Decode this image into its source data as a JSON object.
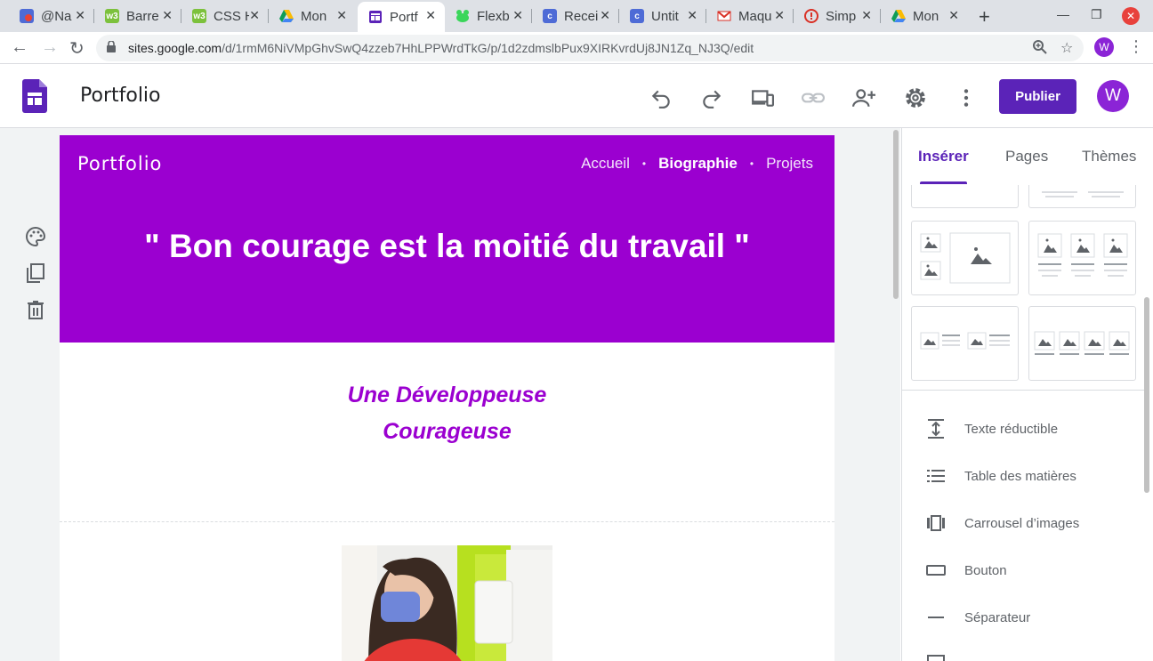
{
  "browser": {
    "tabs": [
      {
        "title": "@Na",
        "fav_color": "#4e6bd6",
        "fav_char": ""
      },
      {
        "title": "Barre",
        "fav_color": "#7cc13c",
        "fav_char": "w3"
      },
      {
        "title": "CSS H",
        "fav_color": "#7cc13c",
        "fav_char": "w3"
      },
      {
        "title": "Mon",
        "fav_color": "#fbbc04",
        "fav_char": ""
      },
      {
        "title": "Portf",
        "fav_color": "#5b23b8",
        "fav_char": ""
      },
      {
        "title": "Flexb",
        "fav_color": "#3ad65a",
        "fav_char": ""
      },
      {
        "title": "Recei",
        "fav_color": "#4e6bd6",
        "fav_char": "c"
      },
      {
        "title": "Untit",
        "fav_color": "#4e6bd6",
        "fav_char": "c"
      },
      {
        "title": "Maqu",
        "fav_color": "#ffffff",
        "fav_char": "M"
      },
      {
        "title": "Simp",
        "fav_color": "#d93025",
        "fav_char": "!"
      },
      {
        "title": "Mon",
        "fav_color": "#fbbc04",
        "fav_char": ""
      }
    ],
    "active_tab": 4,
    "url_host": "sites.google.com",
    "url_path": "/d/1rmM6NiVMpGhvSwQ4zzeb7HhLPPWrdTkG/p/1d2zdmslbPux9XIRKvrdUj8JN1Zq_NJ3Q/edit",
    "profile_initial": "W"
  },
  "app": {
    "title": "Portfolio",
    "publish_label": "Publier",
    "avatar_initial": "W",
    "accent": "#5b23b8"
  },
  "site": {
    "name": "Portfolio",
    "nav": [
      "Accueil",
      "Biographie",
      "Projets"
    ],
    "current_nav": "Biographie",
    "hero_color": "#9b00d0",
    "quote": "\" Bon courage est la moitié du travail \"",
    "subtitle_line1": "Une Développeuse",
    "subtitle_line2": "Courageuse"
  },
  "panel": {
    "tabs": [
      "Insérer",
      "Pages",
      "Thèmes"
    ],
    "active_tab": "Insérer",
    "elements": [
      {
        "label": "Texte réductible",
        "icon": "collapsible-text-icon"
      },
      {
        "label": "Table des matières",
        "icon": "table-of-contents-icon"
      },
      {
        "label": "Carrousel d’images",
        "icon": "image-carousel-icon"
      },
      {
        "label": "Bouton",
        "icon": "button-icon"
      },
      {
        "label": "Séparateur",
        "icon": "divider-icon"
      }
    ]
  }
}
